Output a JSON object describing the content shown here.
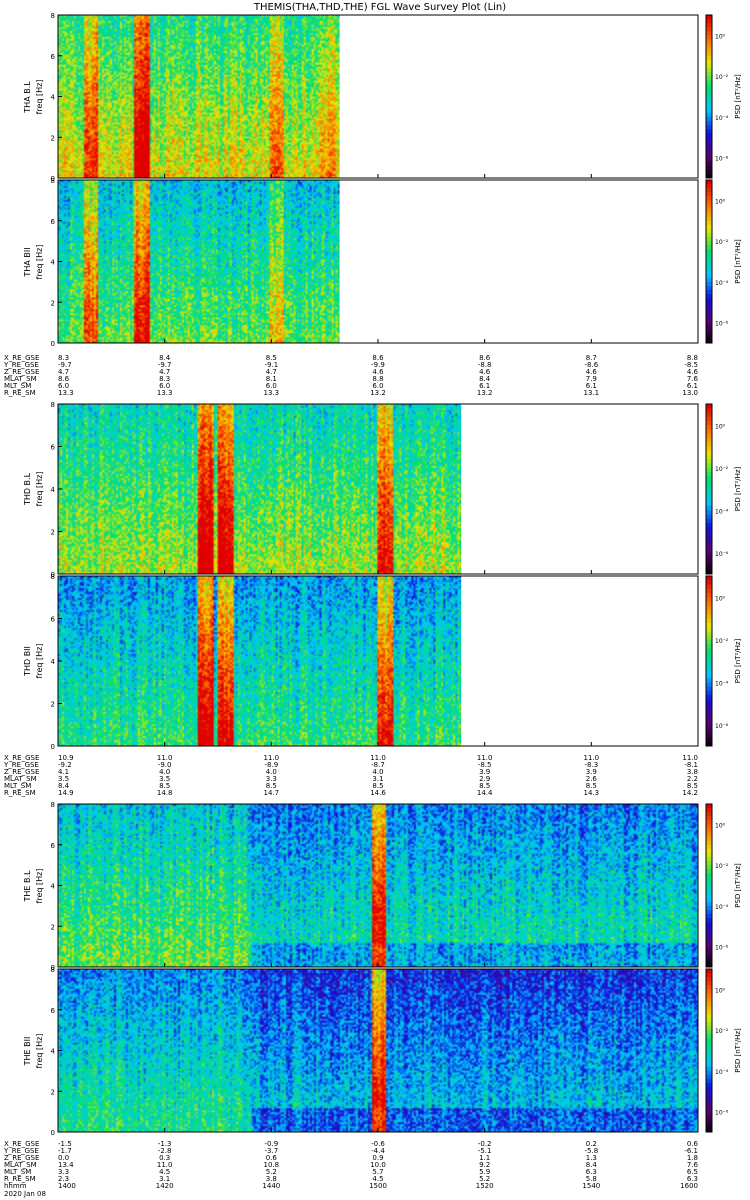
{
  "title": "THEMIS(THA,THD,THE) FGL Wave Survey Plot (Lin)",
  "date_label": "2020 Jan 08",
  "colorbar": {
    "label": "PSD [nT²/Hz]",
    "ticks": [
      "10⁰",
      "10⁻²",
      "10⁻⁴",
      "10⁻⁶"
    ]
  },
  "panels": [
    {
      "ylabel": "THA B.L",
      "yunit": "freq [Hz]"
    },
    {
      "ylabel": "THA BII",
      "yunit": "freq [Hz]"
    },
    {
      "ylabel": "THD B.L",
      "yunit": "freq [Hz]"
    },
    {
      "ylabel": "THD BII",
      "yunit": "freq [Hz]"
    },
    {
      "ylabel": "THE B.L",
      "yunit": "freq [Hz]"
    },
    {
      "ylabel": "THE BII",
      "yunit": "freq [Hz]"
    }
  ],
  "ephemeris": [
    {
      "rows": [
        {
          "name": "X_RE_GSE",
          "values": [
            "8.3",
            "8.4",
            "8.5",
            "8.6",
            "8.6",
            "8.7",
            "8.8"
          ]
        },
        {
          "name": "Y_RE_GSE",
          "values": [
            "-9.7",
            "-9.7",
            "-9.1",
            "-9.9",
            "-8.8",
            "-8.6",
            "-8.5"
          ]
        },
        {
          "name": "Z_RE_GSE",
          "values": [
            "4.7",
            "4.7",
            "4.7",
            "4.6",
            "4.6",
            "4.6",
            "4.6"
          ]
        },
        {
          "name": "MLAT_SM",
          "values": [
            "8.6",
            "8.3",
            "8.1",
            "8.8",
            "8.4",
            "7.9",
            "7.6"
          ]
        },
        {
          "name": "MLT_SM",
          "values": [
            "6.0",
            "6.0",
            "6.0",
            "6.0",
            "6.1",
            "6.1",
            "6.1"
          ]
        },
        {
          "name": "R_RE_SM",
          "values": [
            "13.3",
            "13.3",
            "13.3",
            "13.2",
            "13.2",
            "13.1",
            "13.0"
          ]
        }
      ]
    },
    {
      "rows": [
        {
          "name": "X_RE_GSE",
          "values": [
            "10.9",
            "11.0",
            "11.0",
            "11.0",
            "11.0",
            "11.0",
            "11.0"
          ]
        },
        {
          "name": "Y_RE_GSE",
          "values": [
            "-9.2",
            "-9.0",
            "-8.9",
            "-8.7",
            "-8.5",
            "-8.3",
            "-8.1"
          ]
        },
        {
          "name": "Z_RE_GSE",
          "values": [
            "4.1",
            "4.0",
            "4.0",
            "4.0",
            "3.9",
            "3.9",
            "3.8"
          ]
        },
        {
          "name": "MLAT_SM",
          "values": [
            "3.5",
            "3.5",
            "3.3",
            "3.1",
            "2.9",
            "2.6",
            "2.2"
          ]
        },
        {
          "name": "MLT_SM",
          "values": [
            "8.4",
            "8.5",
            "8.5",
            "8.5",
            "8.5",
            "8.5",
            "8.5"
          ]
        },
        {
          "name": "R_RE_SM",
          "values": [
            "14.9",
            "14.8",
            "14.7",
            "14.6",
            "14.4",
            "14.3",
            "14.2"
          ]
        }
      ]
    },
    {
      "rows": [
        {
          "name": "X_RE_GSE",
          "values": [
            "-1.5",
            "-1.3",
            "-0.9",
            "-0.6",
            "-0.2",
            "0.2",
            "0.6"
          ]
        },
        {
          "name": "Y_RE_GSE",
          "values": [
            "-1.7",
            "-2.8",
            "-3.7",
            "-4.4",
            "-5.1",
            "-5.8",
            "-6.1"
          ]
        },
        {
          "name": "Z_RE_GSE",
          "values": [
            "0.0",
            "0.3",
            "0.6",
            "0.9",
            "1.1",
            "1.3",
            "1.8"
          ]
        },
        {
          "name": "MLAT_SM",
          "values": [
            "13.4",
            "11.0",
            "10.8",
            "10.0",
            "9.2",
            "8.4",
            "7.6"
          ]
        },
        {
          "name": "MLT_SM",
          "values": [
            "3.3",
            "4.5",
            "5.2",
            "5.7",
            "5.9",
            "6.3",
            "6.5"
          ]
        },
        {
          "name": "R_RE_SM",
          "values": [
            "2.3",
            "3.1",
            "3.8",
            "4.5",
            "5.2",
            "5.8",
            "6.3"
          ]
        },
        {
          "name": "hhmm",
          "values": [
            "1400",
            "1420",
            "1440",
            "1500",
            "1520",
            "1540",
            "1600"
          ]
        }
      ]
    }
  ],
  "chart_data": {
    "type": "heatmap",
    "title": "THEMIS(THA,THD,THE) FGL Wave Survey Plot (Lin)",
    "xlabel": "hhmm",
    "x_ticks": [
      "1400",
      "1420",
      "1440",
      "1500",
      "1520",
      "1540",
      "1600"
    ],
    "ylabel": "freq [Hz]",
    "ylim": [
      0,
      8
    ],
    "y_ticks": [
      0,
      2,
      4,
      6,
      8
    ],
    "colorbar_label": "PSD [nT²/Hz]",
    "colorbar_scale": "log",
    "colorbar_range": [
      1e-07,
      10.0
    ],
    "colormap": [
      "#000000",
      "#5a0070",
      "#1010e0",
      "#00c8ff",
      "#00e070",
      "#e8e800",
      "#ff7000",
      "#e00000"
    ],
    "panels": [
      {
        "name": "THA B.L",
        "data_end_fraction": 0.44,
        "base_level": 0.55,
        "features": [
          {
            "x": 0.05,
            "level": 0.8
          },
          {
            "x": 0.13,
            "level": 0.95
          },
          {
            "x": 0.34,
            "level": 0.75
          },
          {
            "x": 0.42,
            "level": 0.7
          }
        ]
      },
      {
        "name": "THA BII",
        "data_end_fraction": 0.44,
        "base_level": 0.45,
        "features": [
          {
            "x": 0.05,
            "level": 0.75
          },
          {
            "x": 0.13,
            "level": 0.85
          },
          {
            "x": 0.34,
            "level": 0.6
          }
        ]
      },
      {
        "name": "THD B.L",
        "data_end_fraction": 0.63,
        "base_level": 0.5,
        "features": [
          {
            "x": 0.23,
            "level": 0.97
          },
          {
            "x": 0.26,
            "level": 0.92
          },
          {
            "x": 0.51,
            "level": 0.85
          }
        ]
      },
      {
        "name": "THD BII",
        "data_end_fraction": 0.63,
        "base_level": 0.4,
        "features": [
          {
            "x": 0.23,
            "level": 0.93
          },
          {
            "x": 0.26,
            "level": 0.88
          },
          {
            "x": 0.51,
            "level": 0.8
          }
        ]
      },
      {
        "name": "THE B.L",
        "data_end_fraction": 1.0,
        "base_level": 0.45,
        "features": [
          {
            "x": 0.17,
            "level": 0.05
          },
          {
            "x": 0.5,
            "level": 1.0
          }
        ]
      },
      {
        "name": "THE BII",
        "data_end_fraction": 1.0,
        "base_level": 0.38,
        "features": [
          {
            "x": 0.17,
            "level": 0.05
          },
          {
            "x": 0.5,
            "level": 1.0
          }
        ]
      }
    ]
  }
}
